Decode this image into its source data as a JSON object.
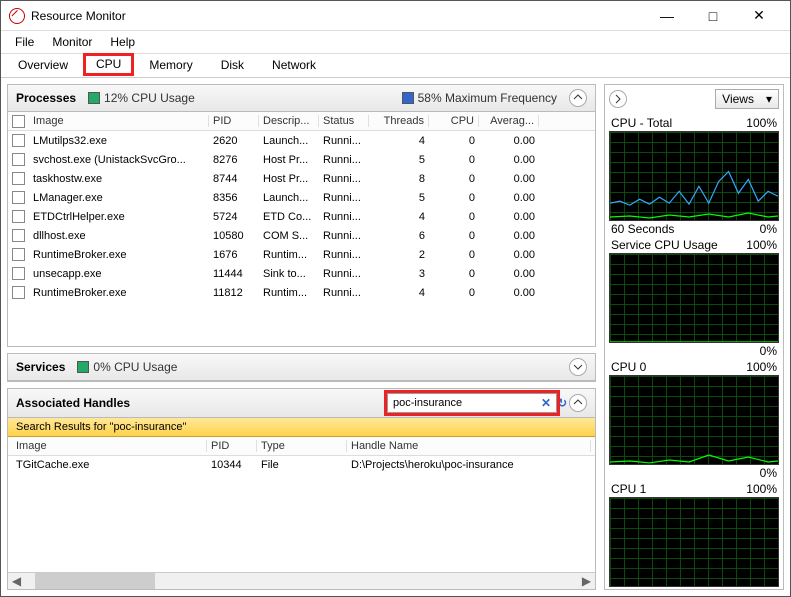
{
  "window": {
    "title": "Resource Monitor"
  },
  "menu": {
    "file": "File",
    "monitor": "Monitor",
    "help": "Help"
  },
  "tabs": {
    "overview": "Overview",
    "cpu": "CPU",
    "memory": "Memory",
    "disk": "Disk",
    "network": "Network"
  },
  "processes": {
    "title": "Processes",
    "cpu_usage": "12% CPU Usage",
    "max_freq": "58% Maximum Frequency",
    "cols": {
      "image": "Image",
      "pid": "PID",
      "desc": "Descrip...",
      "status": "Status",
      "threads": "Threads",
      "cpu": "CPU",
      "avg": "Averag..."
    },
    "rows": [
      {
        "image": "LMutilps32.exe",
        "pid": "2620",
        "desc": "Launch...",
        "status": "Runni...",
        "threads": "4",
        "cpu": "0",
        "avg": "0.00"
      },
      {
        "image": "svchost.exe (UnistackSvcGro...",
        "pid": "8276",
        "desc": "Host Pr...",
        "status": "Runni...",
        "threads": "5",
        "cpu": "0",
        "avg": "0.00"
      },
      {
        "image": "taskhostw.exe",
        "pid": "8744",
        "desc": "Host Pr...",
        "status": "Runni...",
        "threads": "8",
        "cpu": "0",
        "avg": "0.00"
      },
      {
        "image": "LManager.exe",
        "pid": "8356",
        "desc": "Launch...",
        "status": "Runni...",
        "threads": "5",
        "cpu": "0",
        "avg": "0.00"
      },
      {
        "image": "ETDCtrlHelper.exe",
        "pid": "5724",
        "desc": "ETD Co...",
        "status": "Runni...",
        "threads": "4",
        "cpu": "0",
        "avg": "0.00"
      },
      {
        "image": "dllhost.exe",
        "pid": "10580",
        "desc": "COM S...",
        "status": "Runni...",
        "threads": "6",
        "cpu": "0",
        "avg": "0.00"
      },
      {
        "image": "RuntimeBroker.exe",
        "pid": "1676",
        "desc": "Runtim...",
        "status": "Runni...",
        "threads": "2",
        "cpu": "0",
        "avg": "0.00"
      },
      {
        "image": "unsecapp.exe",
        "pid": "11444",
        "desc": "Sink to...",
        "status": "Runni...",
        "threads": "3",
        "cpu": "0",
        "avg": "0.00"
      },
      {
        "image": "RuntimeBroker.exe",
        "pid": "11812",
        "desc": "Runtim...",
        "status": "Runni...",
        "threads": "4",
        "cpu": "0",
        "avg": "0.00"
      }
    ]
  },
  "services": {
    "title": "Services",
    "cpu_usage": "0% CPU Usage"
  },
  "handles": {
    "title": "Associated Handles",
    "search_value": "poc-insurance",
    "results_label": "Search Results for \"poc-insurance\"",
    "cols": {
      "image": "Image",
      "pid": "PID",
      "type": "Type",
      "handle": "Handle Name"
    },
    "rows": [
      {
        "image": "TGitCache.exe",
        "pid": "10344",
        "type": "File",
        "handle": "D:\\Projects\\heroku\\poc-insurance"
      }
    ]
  },
  "right": {
    "views": "Views",
    "charts": [
      {
        "title": "CPU - Total",
        "pct": "100%",
        "foot_l": "60 Seconds",
        "foot_r": "0%"
      },
      {
        "title": "Service CPU Usage",
        "pct": "100%",
        "foot_l": "",
        "foot_r": "0%"
      },
      {
        "title": "CPU 0",
        "pct": "100%",
        "foot_l": "",
        "foot_r": "0%"
      },
      {
        "title": "CPU 1",
        "pct": "100%",
        "foot_l": "",
        "foot_r": ""
      }
    ]
  }
}
